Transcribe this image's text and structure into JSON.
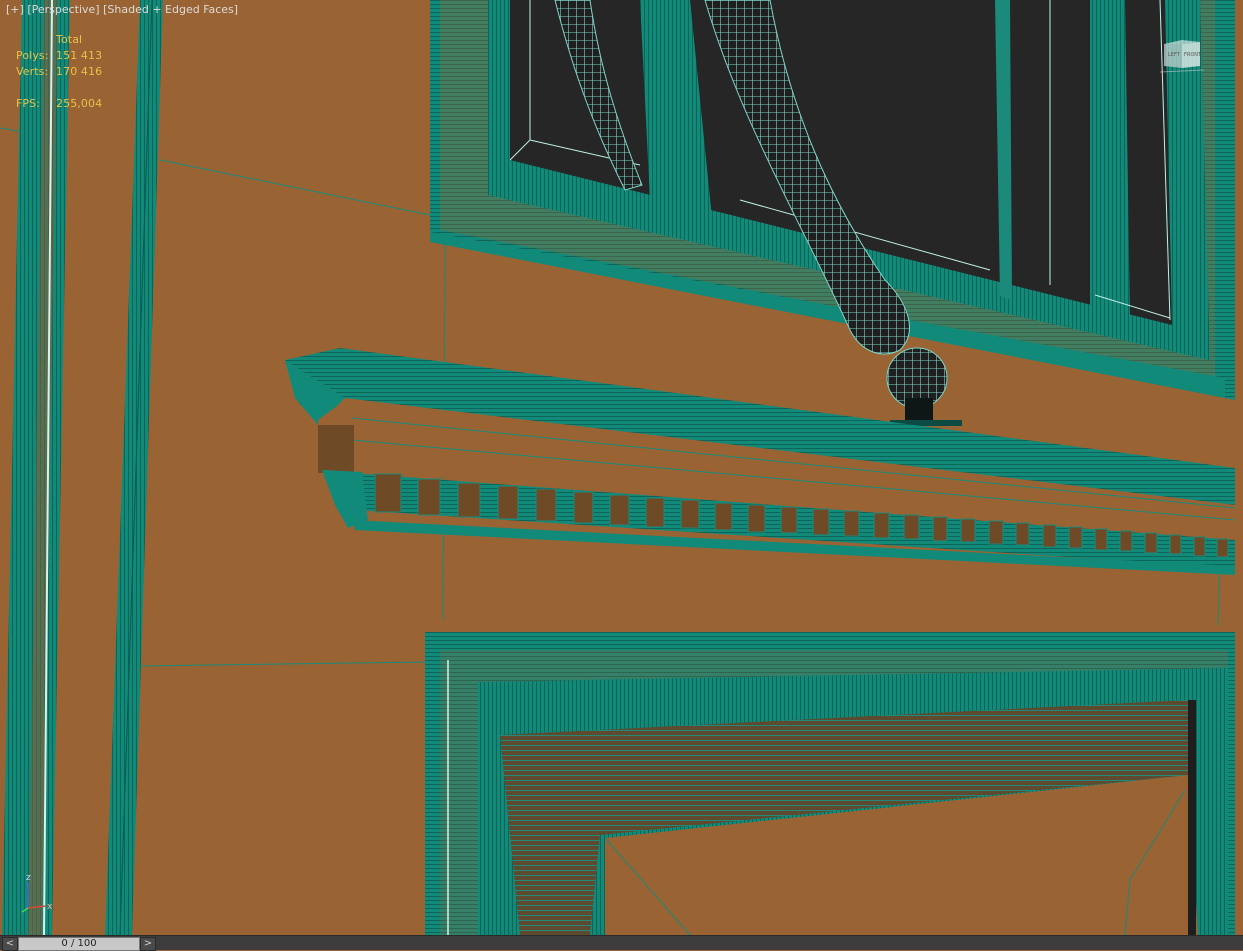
{
  "viewport": {
    "label_plus": "[+]",
    "label_view": "[Perspective]",
    "label_mode": "[Shaded + Edged Faces]",
    "stats": {
      "header": "Total",
      "polys_label": "Polys:",
      "polys_value": "151 413",
      "verts_label": "Verts:",
      "verts_value": "170 416",
      "fps_label": "FPS:",
      "fps_value": "255,004"
    },
    "viewcube": {
      "left_face": "LEFT",
      "front_face": "FRONT"
    },
    "axis": {
      "x": "x",
      "z": "z"
    }
  },
  "timeslider": {
    "prev": "<",
    "position": "0 / 100",
    "next": ">"
  },
  "colors": {
    "wall": "#9a6333",
    "trim": "#128a7a",
    "trim_light": "#1fa08f",
    "edge": "#0c5e54",
    "glass": "#262626",
    "overlay_text": "#e8c24a"
  }
}
